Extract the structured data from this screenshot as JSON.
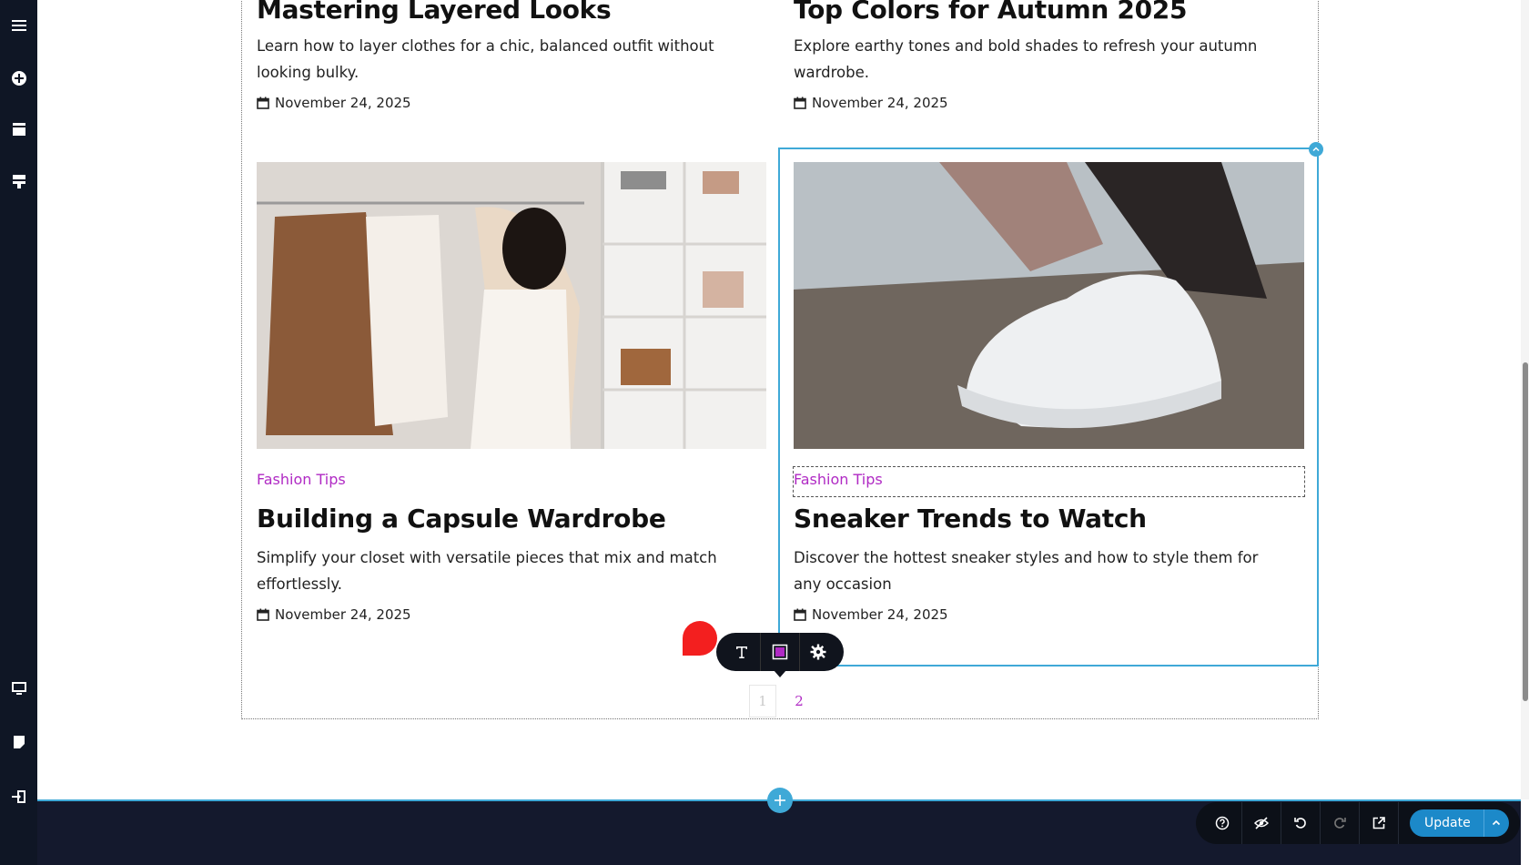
{
  "posts": [
    {
      "title": "Mastering Layered Looks",
      "description": "Learn how to layer clothes for a chic, balanced outfit without looking bulky.",
      "date": "November 24, 2025"
    },
    {
      "title": "Top Colors for Autumn 2025",
      "description": "Explore earthy tones and bold shades to refresh your autumn wardrobe.",
      "date": "November 24, 2025"
    },
    {
      "category": "Fashion Tips",
      "title": "Building a Capsule Wardrobe",
      "description": "Simplify your closet with versatile pieces that mix and match effortlessly.",
      "date": "November 24, 2025"
    },
    {
      "category": "Fashion Tips",
      "title": "Sneaker Trends to Watch",
      "description": "Discover the hottest sneaker styles and how to style them for any occasion",
      "date": "November 24, 2025"
    }
  ],
  "pagination": {
    "page1": "1",
    "page2": "2"
  },
  "toolbar": {
    "update_label": "Update"
  },
  "colors": {
    "accent": "#3fa9d7",
    "category": "#b02ac4",
    "update": "#1c89c9",
    "rail": "#0f1625",
    "footer": "#14192d"
  }
}
